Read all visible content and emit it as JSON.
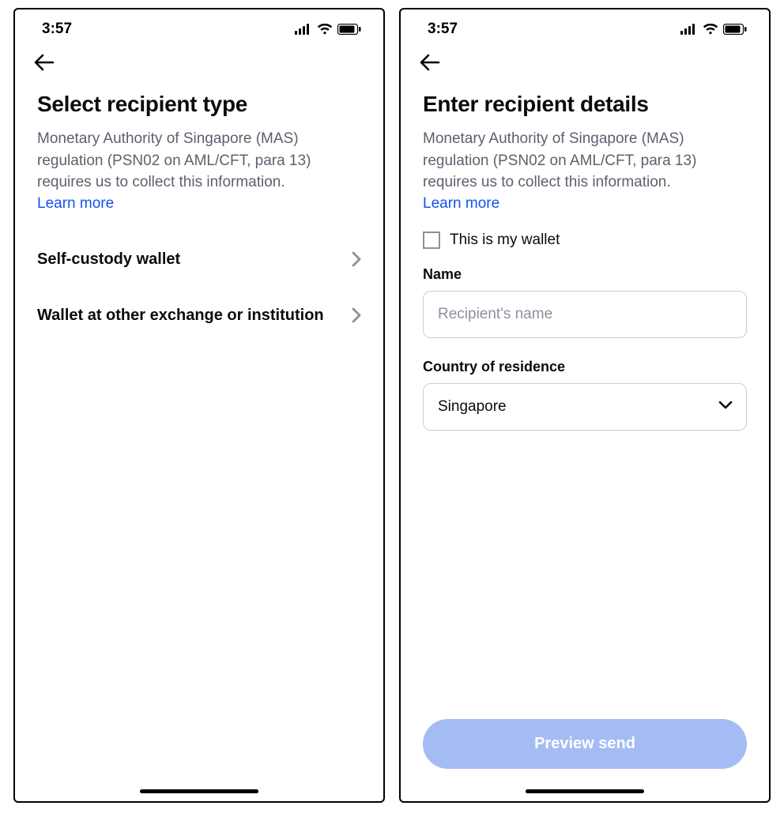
{
  "status": {
    "time": "3:57"
  },
  "screen1": {
    "title": "Select recipient type",
    "description": "Monetary Authority of Singapore (MAS) regulation (PSN02 on AML/CFT, para 13) requires us to collect this information.",
    "learn_more": "Learn more",
    "options": {
      "self_custody": "Self-custody wallet",
      "other_exchange": "Wallet at other exchange or institution"
    }
  },
  "screen2": {
    "title": "Enter recipient details",
    "description": "Monetary Authority of Singapore (MAS) regulation (PSN02 on AML/CFT, para 13) requires us to collect this information.",
    "learn_more": "Learn more",
    "my_wallet_label": "This is my wallet",
    "name_label": "Name",
    "name_placeholder": "Recipient's name",
    "country_label": "Country of residence",
    "country_value": "Singapore",
    "primary_button": "Preview send"
  }
}
